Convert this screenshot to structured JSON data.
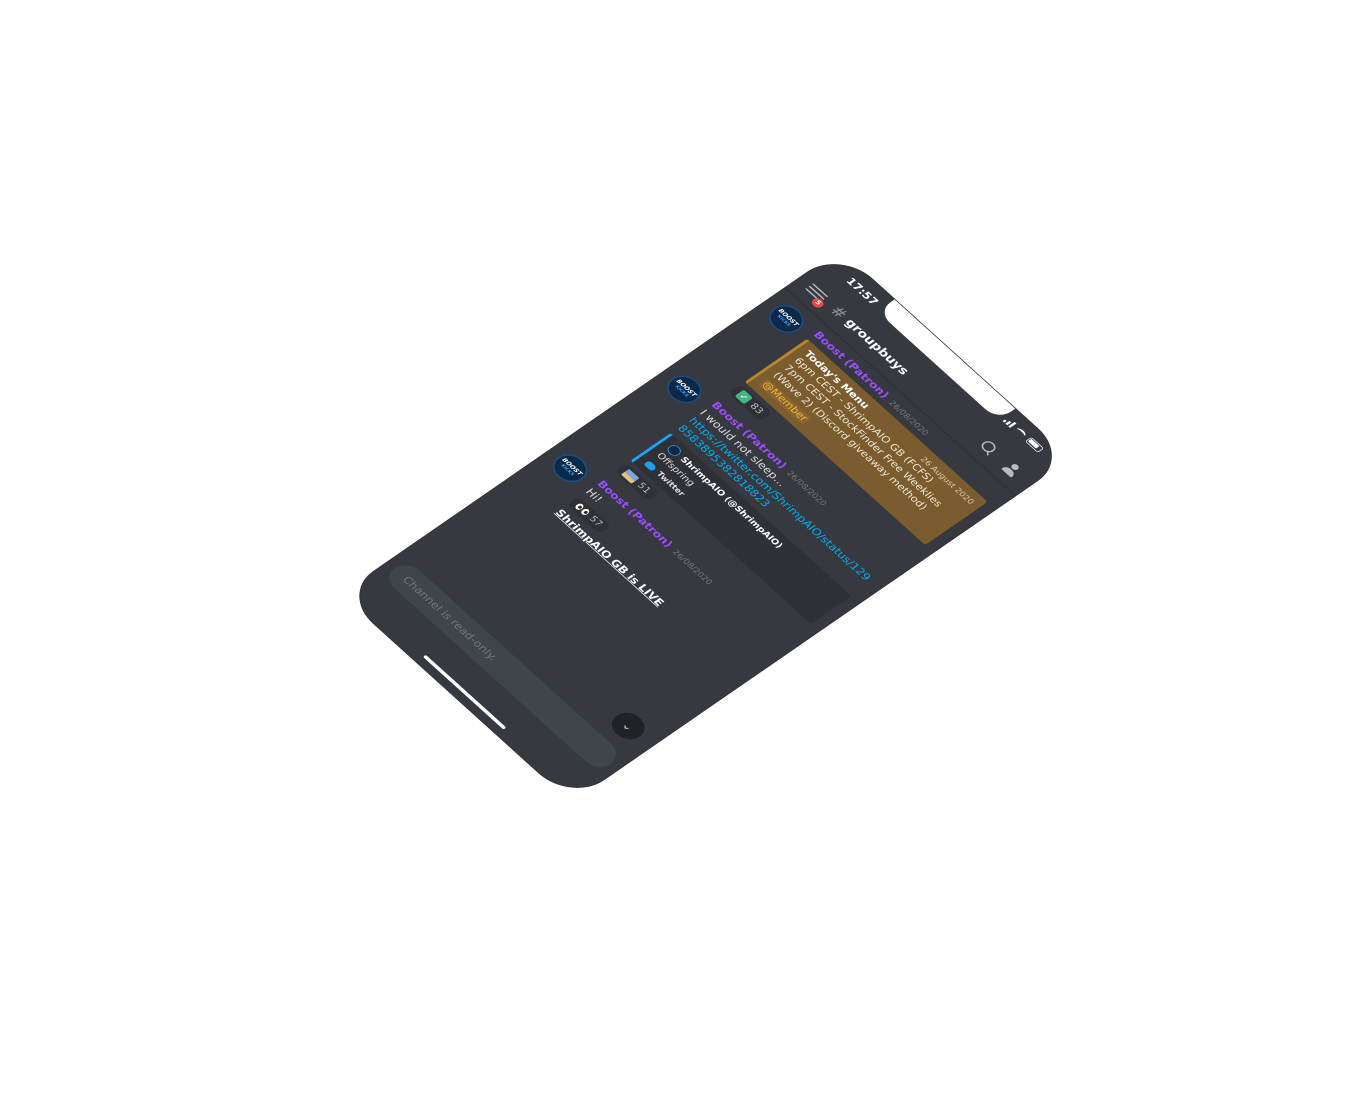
{
  "status": {
    "time": "17:57"
  },
  "header": {
    "menu_badge": "5",
    "hash": "#",
    "channel": "groupbuys"
  },
  "messages": [
    {
      "avatar": {
        "line1": "BOOST",
        "line2": "KICKS"
      },
      "author": "Boost (Patron)",
      "timestamp": "26/08/2020",
      "embed": {
        "title": "Today's Menu",
        "date": "26 August 2020",
        "lines": [
          "6pm CEST - ShrimpAIO GB (FCFS)",
          "7pm CEST - StockFinder Free Weeklies (Wave 2) (Discord giveaway method)"
        ],
        "mention": "@Member"
      },
      "reaction": {
        "emoji": "check-emoji",
        "count": "83"
      }
    },
    {
      "avatar": {
        "line1": "BOOST",
        "line2": "KICKS"
      },
      "author": "Boost (Patron)",
      "timestamp": "26/08/2020",
      "text": "I would not sleep...",
      "link": "https://twitter.com/ShrimpAIO/status/1298583895382818823",
      "twitter": {
        "author": "ShrimpAIO (@ShrimpAIO)",
        "body": "Offspring",
        "footer": "Twitter"
      },
      "reaction": {
        "emoji": "photo-emoji",
        "count": "51"
      }
    },
    {
      "avatar": {
        "line1": "BOOST",
        "line2": "KICKS"
      },
      "author": "Boost (Patron)",
      "timestamp": "26/08/2020",
      "text": "Hi!",
      "reaction": {
        "emoji": "eyes-emoji",
        "count": "57"
      },
      "title": "ShrimpAIO GB is LIVE"
    }
  ],
  "input": {
    "placeholder": "Channel is read-only."
  },
  "scroll_button": {
    "glyph": "⌄"
  },
  "colors": {
    "background": "#36393f",
    "author": "#9b4dff",
    "embed": "#7a5c2e",
    "mention": "#f3b53a",
    "link": "#00aff4",
    "twitter_accent": "#1da1f2"
  }
}
